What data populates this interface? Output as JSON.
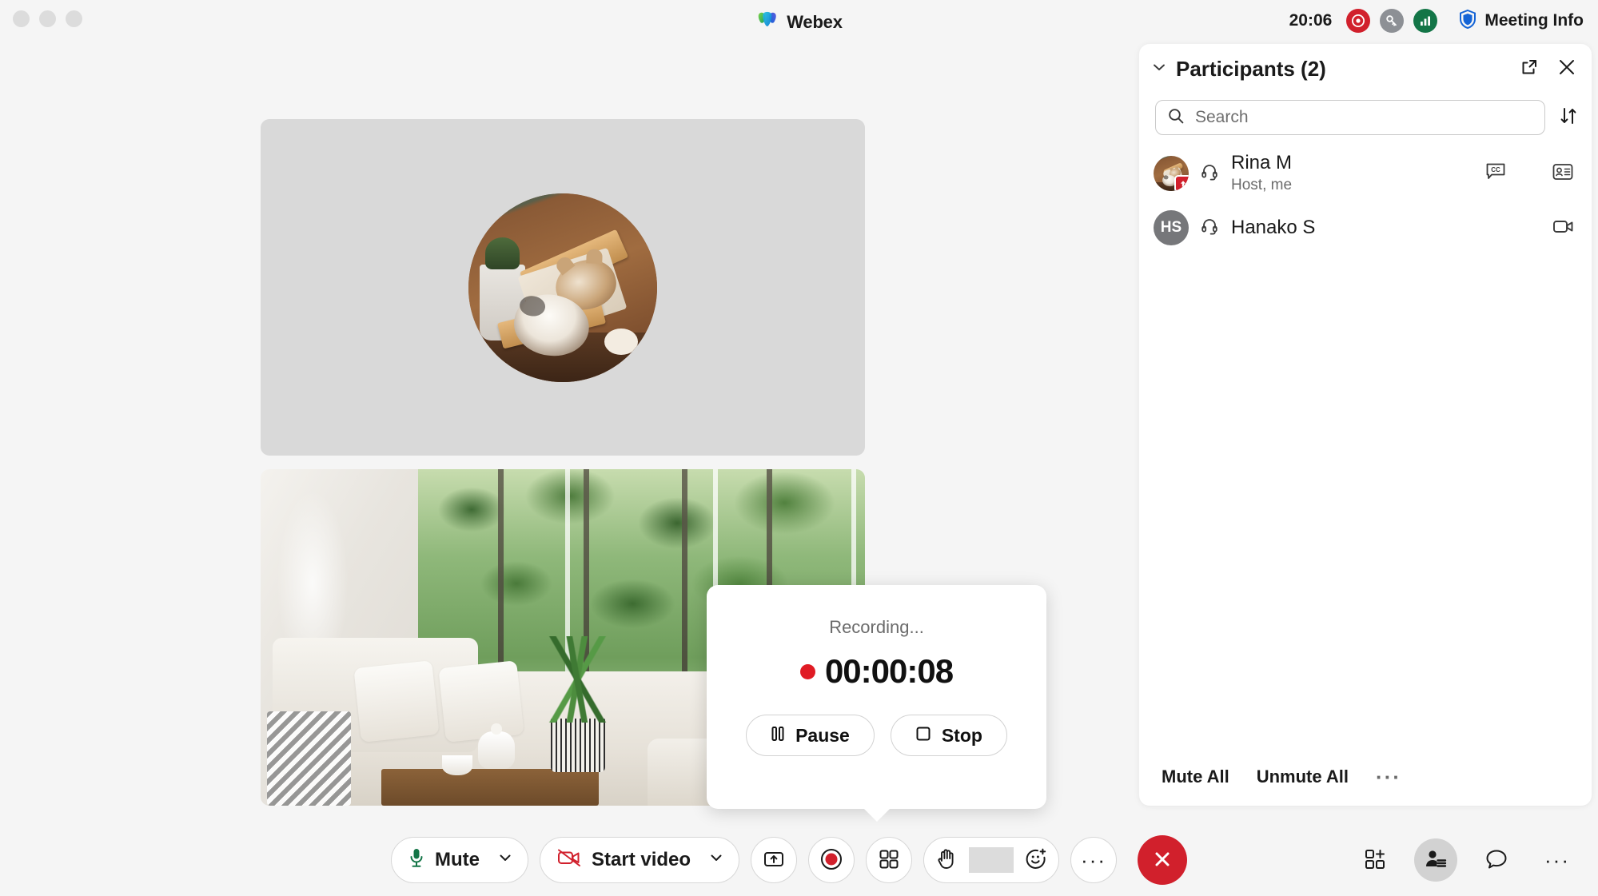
{
  "titlebar": {
    "app_name": "Webex",
    "time": "20:06",
    "meeting_info_label": "Meeting Info",
    "icons": {
      "recording": "record-circle-icon",
      "key": "encryption-key-icon",
      "signal": "network-signal-icon",
      "shield": "security-shield-icon"
    }
  },
  "recording_popover": {
    "status": "Recording...",
    "elapsed": "00:00:08",
    "pause_label": "Pause",
    "stop_label": "Stop"
  },
  "panel": {
    "title": "Participants (2)",
    "search_placeholder": "Search",
    "search_value": "",
    "participants": [
      {
        "initials": "",
        "name": "Rina M",
        "role": "Host, me",
        "audio": "headset-icon",
        "sharing": true,
        "row_icons": [
          "cc-icon",
          "id-card-icon"
        ]
      },
      {
        "initials": "HS",
        "name": "Hanako S",
        "role": "",
        "audio": "headset-icon",
        "sharing": false,
        "row_icons": [
          "video-camera-icon"
        ]
      }
    ],
    "mute_all_label": "Mute All",
    "unmute_all_label": "Unmute All",
    "more_label": "···"
  },
  "controls": {
    "mute_label": "Mute",
    "video_label": "Start video",
    "more_label": "···",
    "right_more_label": "···"
  },
  "colors": {
    "accent_red": "#d1202c",
    "record_dot": "#e01b24",
    "mic_green": "#137547",
    "video_red": "#d1202c",
    "panel_bg": "#ffffff",
    "app_bg": "#f5f5f5",
    "tile_bg": "#d9d9d9"
  }
}
